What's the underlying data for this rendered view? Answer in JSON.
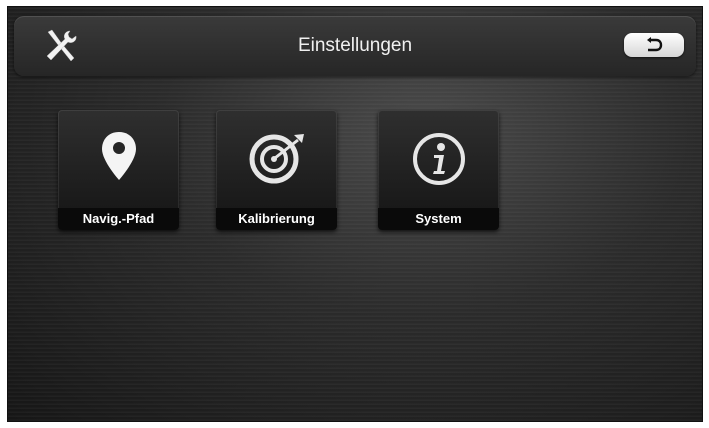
{
  "header": {
    "title": "Einstellungen",
    "tools_icon": "tools-icon",
    "back_icon": "back-arrow-icon"
  },
  "menu": [
    {
      "label": "Navig.-Pfad",
      "icon": "location-pin-icon"
    },
    {
      "label": "Kalibrierung",
      "icon": "target-icon"
    },
    {
      "label": "System",
      "icon": "info-icon"
    }
  ],
  "colors": {
    "background": "#262626",
    "text": "#f0f0f0",
    "label_bar": "#0a0a0a"
  }
}
